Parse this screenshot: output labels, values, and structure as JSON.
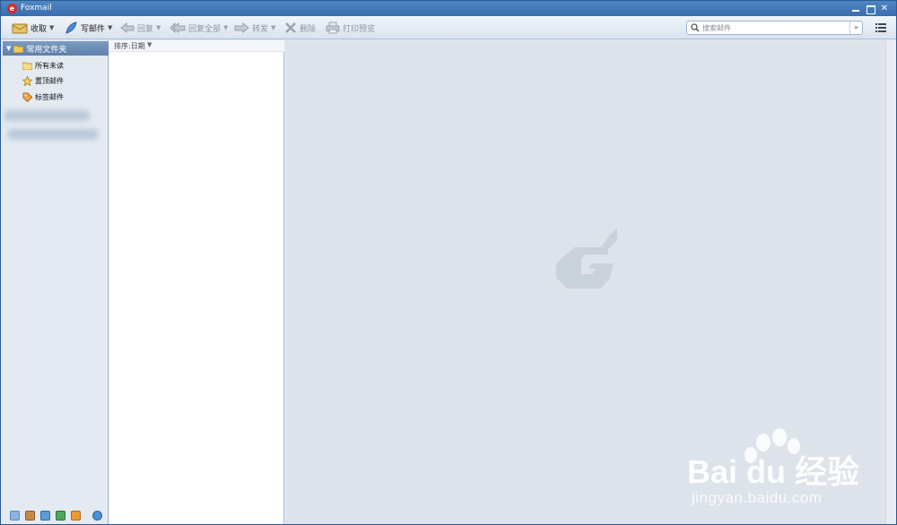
{
  "window": {
    "title": "Foxmail"
  },
  "toolbar": {
    "receive_label": "收取",
    "compose_label": "写邮件",
    "reply_label": "回复",
    "reply_all_label": "回复全部",
    "forward_label": "转发",
    "delete_label": "删除",
    "print_preview_label": "打印预览"
  },
  "search": {
    "placeholder": "搜索邮件",
    "value": ""
  },
  "sidebar": {
    "group_label": "常用文件夹",
    "items": [
      {
        "label": "所有未读",
        "icon": "folder-icon"
      },
      {
        "label": "置顶邮件",
        "icon": "star-icon"
      },
      {
        "label": "标签邮件",
        "icon": "tag-icon"
      }
    ],
    "bottom_icons": [
      "mail-icon",
      "contacts-icon",
      "calendar-icon",
      "notes-icon",
      "rss-icon",
      "sync-icon"
    ]
  },
  "message_list": {
    "sort_label": "排序:日期"
  },
  "watermark": {
    "brand": "Bai du 经验",
    "url": "jingyan.baidu.com"
  },
  "colors": {
    "titlebar": "#3a6eae",
    "pane": "#dde3ea",
    "sidebar": "#e4eaf2"
  }
}
